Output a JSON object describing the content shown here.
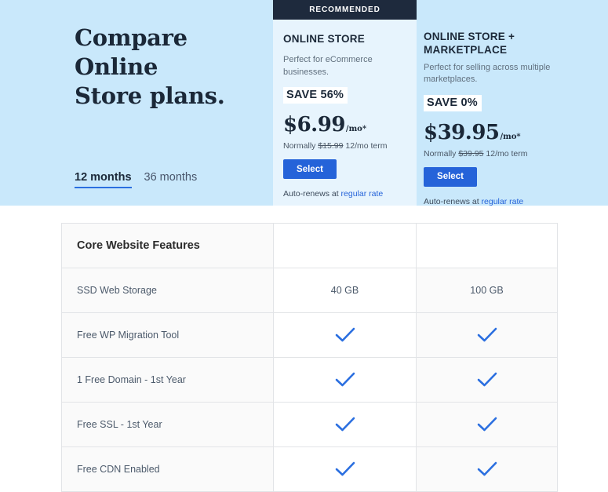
{
  "hero": {
    "title_line1": "Compare Online",
    "title_line2": "Store plans.",
    "term_active": "12 months",
    "term_inactive": "36 months"
  },
  "plans": [
    {
      "ribbon": "RECOMMENDED",
      "name": "ONLINE STORE",
      "description": "Perfect for eCommerce businesses.",
      "save_badge": "SAVE 56%",
      "price": "$6.99",
      "price_suffix": "/mo*",
      "normally_prefix": "Normally",
      "normally_price": "$15.99",
      "normally_term": "12/mo term",
      "select_label": "Select",
      "renew_prefix": "Auto-renews at",
      "renew_link": "regular rate"
    },
    {
      "ribbon": "",
      "name": "ONLINE STORE + MARKETPLACE",
      "description": "Perfect for selling across multiple marketplaces.",
      "save_badge": "SAVE 0%",
      "price": "$39.95",
      "price_suffix": "/mo*",
      "normally_prefix": "Normally",
      "normally_price": "$39.95",
      "normally_term": "12/mo term",
      "select_label": "Select",
      "renew_prefix": "Auto-renews at",
      "renew_link": "regular rate"
    }
  ],
  "table": {
    "section_title": "Core Website Features",
    "rows": [
      {
        "label": "SSD Web Storage",
        "plan_a": "40 GB",
        "plan_b": "100 GB",
        "type": "text"
      },
      {
        "label": "Free WP Migration Tool",
        "plan_a": "check",
        "plan_b": "check",
        "type": "check"
      },
      {
        "label": "1 Free Domain - 1st Year",
        "plan_a": "check",
        "plan_b": "check",
        "type": "check"
      },
      {
        "label": "Free SSL - 1st Year",
        "plan_a": "check",
        "plan_b": "check",
        "type": "check"
      },
      {
        "label": "Free CDN Enabled",
        "plan_a": "check",
        "plan_b": "check",
        "type": "check"
      }
    ]
  },
  "colors": {
    "hero_bg": "#c9e8fb",
    "card_recommended_bg": "#e7f4fd",
    "ribbon_bg": "#1e2a3d",
    "accent_blue": "#2563d9",
    "check_blue": "#2b6fe0",
    "text_dark": "#1b2838"
  }
}
